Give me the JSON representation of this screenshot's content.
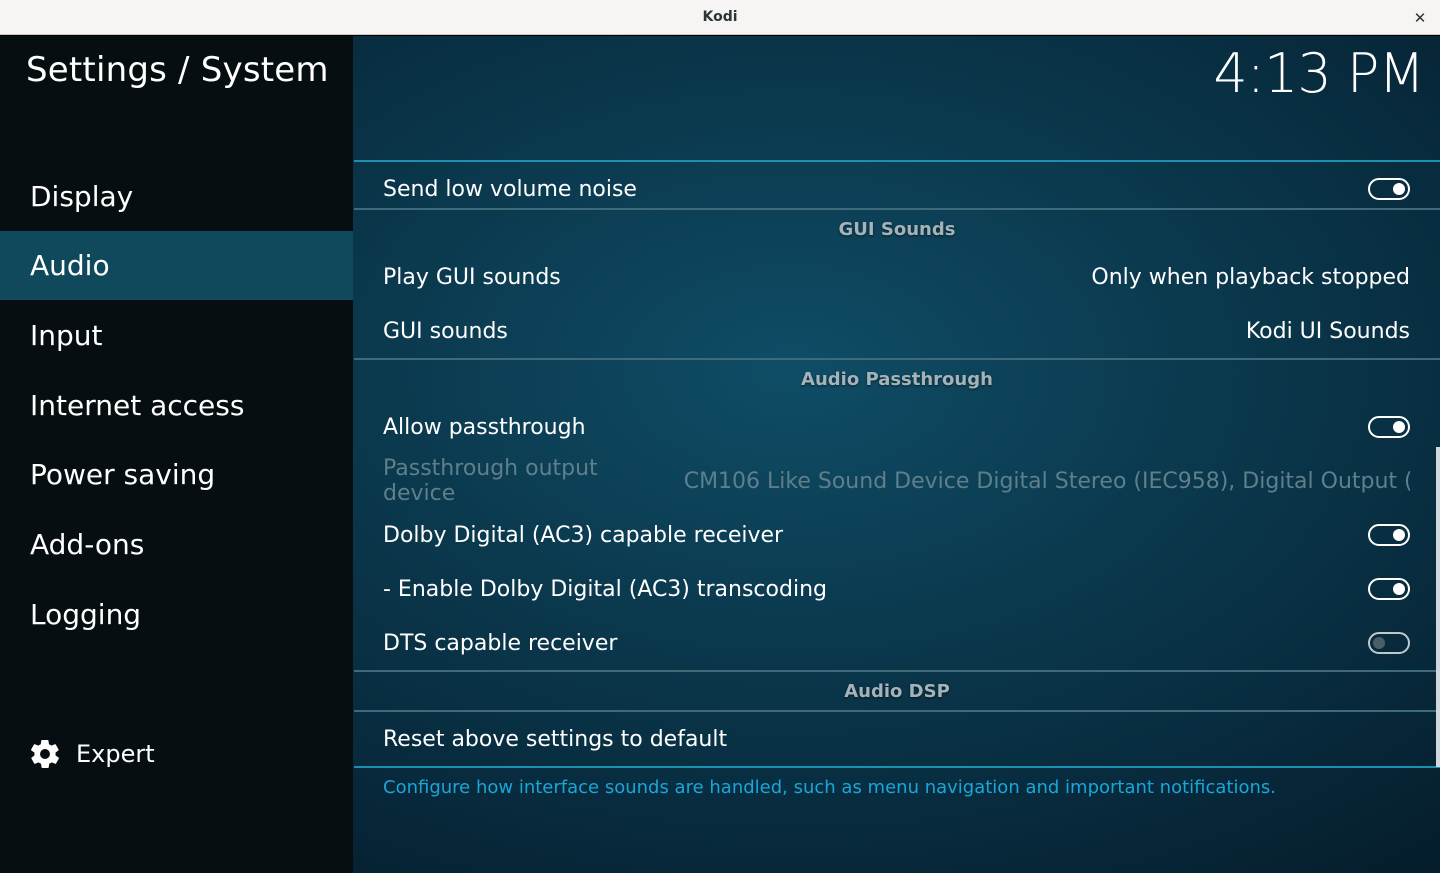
{
  "window": {
    "title": "Kodi",
    "close_glyph": "✕"
  },
  "header": {
    "breadcrumb": "Settings / System",
    "clock": "4:13 PM"
  },
  "sidebar": {
    "items": [
      {
        "label": "Display",
        "active": false
      },
      {
        "label": "Audio",
        "active": true
      },
      {
        "label": "Input",
        "active": false
      },
      {
        "label": "Internet access",
        "active": false
      },
      {
        "label": "Power saving",
        "active": false
      },
      {
        "label": "Add-ons",
        "active": false
      },
      {
        "label": "Logging",
        "active": false
      }
    ],
    "level_label": "Expert",
    "level_icon": "gear-icon"
  },
  "settings": {
    "send_low_volume_noise": {
      "label": "Send low volume noise",
      "enabled": true
    },
    "gui_sounds_section": "GUI Sounds",
    "play_gui_sounds": {
      "label": "Play GUI sounds",
      "value": "Only when playback stopped"
    },
    "gui_sounds": {
      "label": "GUI sounds",
      "value": "Kodi UI Sounds"
    },
    "passthrough_section": "Audio Passthrough",
    "allow_passthrough": {
      "label": "Allow passthrough",
      "enabled": true
    },
    "passthrough_output_device": {
      "label": "Passthrough output device",
      "value": "CM106 Like Sound Device Digital Stereo (IEC958), Digital Output (..."
    },
    "dolby_ac3_receiver": {
      "label": "Dolby Digital (AC3) capable receiver",
      "enabled": true
    },
    "dolby_ac3_transcoding": {
      "label": "- Enable Dolby Digital (AC3) transcoding",
      "enabled": true
    },
    "dts_receiver": {
      "label": "DTS capable receiver",
      "enabled": false
    },
    "dsp_section": "Audio DSP",
    "reset": {
      "label": "Reset above settings to default"
    }
  },
  "help_text": "Configure how interface sounds are handled, such as menu navigation and important notifications.",
  "colors": {
    "accent": "#1aa6d8",
    "active_item": "#11495c",
    "sidebar_bg": "#070e12"
  }
}
